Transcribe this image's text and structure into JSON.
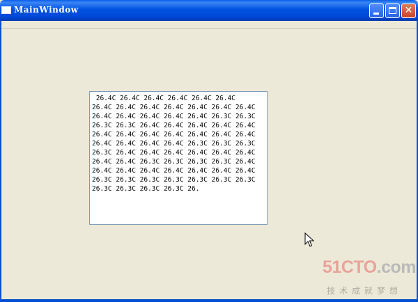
{
  "window": {
    "title": "MainWindow",
    "controls": [
      "minimize-icon",
      "maximize-icon",
      "close-icon"
    ]
  },
  "text_area": {
    "content": " 26.4C 26.4C 26.4C 26.4C 26.4C 26.4C\n26.4C 26.4C 26.4C 26.4C 26.4C 26.4C 26.4C\n26.4C 26.4C 26.4C 26.4C 26.4C 26.3C 26.3C\n26.3C 26.3C 26.4C 26.4C 26.4C 26.4C 26.4C\n26.4C 26.4C 26.4C 26.4C 26.4C 26.4C 26.4C\n26.4C 26.4C 26.4C 26.4C 26.3C 26.3C 26.3C\n26.3C 26.4C 26.4C 26.4C 26.4C 26.4C 26.4C\n26.4C 26.4C 26.3C 26.3C 26.3C 26.3C 26.4C\n26.4C 26.4C 26.4C 26.4C 26.4C 26.4C 26.4C\n26.3C 26.3C 26.3C 26.3C 26.3C 26.3C 26.3C\n26.3C 26.3C 26.3C 26.3C 26."
  },
  "watermark": {
    "brand_part1": "51CTO",
    "brand_part2": ".com",
    "tagline": "技术成就梦想"
  },
  "colors": {
    "titlebar": "#0052e0",
    "client_background": "#ece9d8",
    "panel_border": "#7f9db9"
  }
}
